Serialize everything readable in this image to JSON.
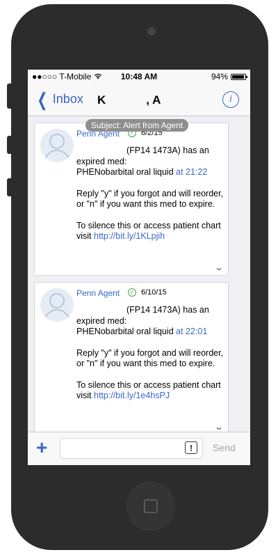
{
  "status_bar": {
    "carrier": "●●○○○ T-Mobile",
    "wifi_icon": "wifi-icon",
    "time": "10:48 AM",
    "battery_text": "94%",
    "battery_level": 0.94
  },
  "nav": {
    "back_label": "Inbox",
    "title_first": "K",
    "title_last": ", A",
    "info_icon": "i"
  },
  "subject": "Subject: Alert from Agent",
  "messages": [
    {
      "sender": "Penn Agent",
      "date": "6/2/15",
      "mrn": "(FP14 1473A) has an",
      "line2": "expired med:",
      "med": "PHENobarbital oral liquid ",
      "time_link": "at 21:22",
      "reply": "Reply \"y\" if you forgot and will reorder, or \"n\" if you want this med to expire.",
      "silence": "To silence this or access patient chart visit ",
      "url": "http://bit.ly/1KLpjih"
    },
    {
      "sender": "Penn Agent",
      "date": "6/10/15",
      "mrn": "(FP14 1473A) has an",
      "line2": "expired med:",
      "med": "PHENobarbital oral liquid ",
      "time_link": "at 22:01",
      "reply": "Reply \"y\" if you forgot and will reorder, or \"n\" if you want this med to expire.",
      "silence": "To silence this or access patient chart visit ",
      "url": "http://bit.ly/1e4hsPJ"
    }
  ],
  "composer": {
    "plus": "+",
    "alert_icon": "!",
    "send_label": "Send"
  },
  "colors": {
    "accent": "#3a66c8",
    "verified": "#3aa84a"
  }
}
